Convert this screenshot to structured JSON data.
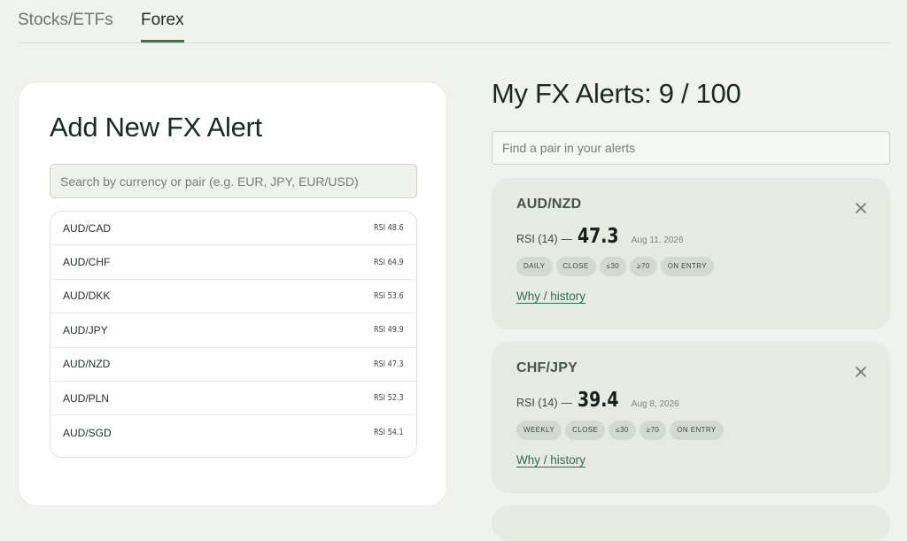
{
  "tabs": [
    {
      "label": "Stocks/ETFs",
      "active": false
    },
    {
      "label": "Forex",
      "active": true
    }
  ],
  "add_panel": {
    "title": "Add New FX Alert",
    "search_placeholder": "Search by currency or pair (e.g. EUR, JPY, EUR/USD)",
    "pairs": [
      {
        "pair": "AUD/CAD",
        "rsi": "RSI 48.6"
      },
      {
        "pair": "AUD/CHF",
        "rsi": "RSI 64.9"
      },
      {
        "pair": "AUD/DKK",
        "rsi": "RSI 53.6"
      },
      {
        "pair": "AUD/JPY",
        "rsi": "RSI 49.9"
      },
      {
        "pair": "AUD/NZD",
        "rsi": "RSI 47.3"
      },
      {
        "pair": "AUD/PLN",
        "rsi": "RSI 52.3"
      },
      {
        "pair": "AUD/SGD",
        "rsi": "RSI 54.1"
      }
    ]
  },
  "alerts_panel": {
    "title": "My FX Alerts: 9 / 100",
    "search_placeholder": "Find a pair in your alerts",
    "alerts": [
      {
        "pair": "AUD/NZD",
        "rsi_label": "RSI (14)",
        "rsi_dash": "—",
        "rsi_value": "47.3",
        "date": "Aug 11, 2026",
        "chips": [
          "DAILY",
          "CLOSE",
          "≤30",
          "≥70",
          "ON ENTRY"
        ],
        "link": "Why / history"
      },
      {
        "pair": "CHF/JPY",
        "rsi_label": "RSI (14)",
        "rsi_dash": "—",
        "rsi_value": "39.4",
        "date": "Aug 8, 2026",
        "chips": [
          "WEEKLY",
          "CLOSE",
          "≤30",
          "≥70",
          "ON ENTRY"
        ],
        "link": "Why / history"
      }
    ]
  },
  "icons": {
    "close": "close-icon"
  },
  "colors": {
    "accent": "#3a7a52",
    "link": "#2e7048",
    "page_bg": "#f0f3ed",
    "card_bg": "#e5eae2",
    "chip_bg": "#d2d9cf"
  }
}
